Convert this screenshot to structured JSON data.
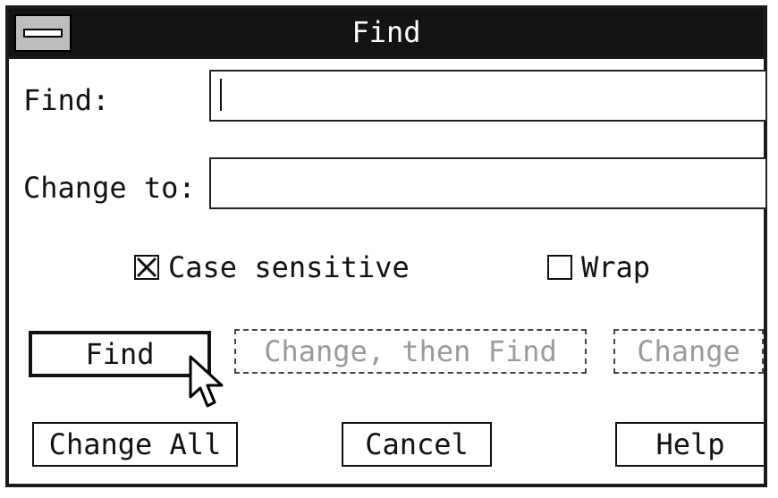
{
  "window": {
    "title": "Find"
  },
  "fields": {
    "find_label": "Find:",
    "find_value": "",
    "change_to_label": "Change to:",
    "change_to_value": ""
  },
  "options": {
    "case_sensitive": {
      "label": "Case sensitive",
      "checked": true
    },
    "wrap": {
      "label": "Wrap",
      "checked": false
    }
  },
  "buttons": {
    "find": "Find",
    "change_then_find": "Change, then Find",
    "change": "Change",
    "change_all": "Change All",
    "cancel": "Cancel",
    "help": "Help"
  }
}
